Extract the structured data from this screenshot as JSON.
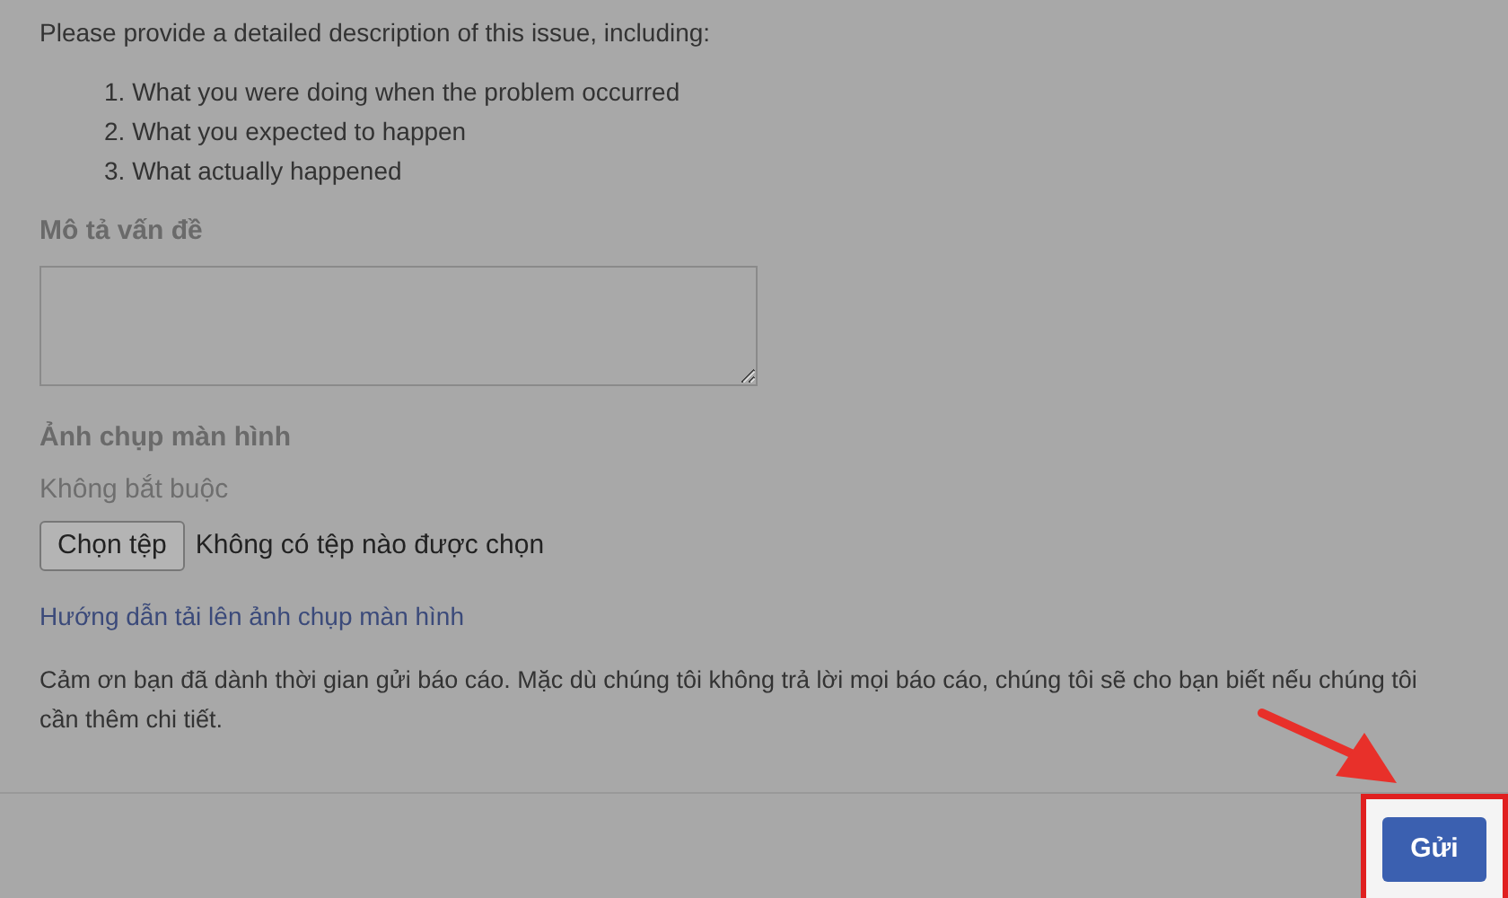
{
  "intro": "Please provide a detailed description of this issue, including:",
  "steps": [
    "1. What you were doing when the problem occurred",
    "2. What you expected to happen",
    "3. What actually happened"
  ],
  "description": {
    "label": "Mô tả vấn đề"
  },
  "screenshot": {
    "label": "Ảnh chụp màn hình",
    "hint": "Không bắt buộc",
    "button": "Chọn tệp",
    "status": "Không có tệp nào được chọn"
  },
  "help_link": "Hướng dẫn tải lên ảnh chụp màn hình",
  "thanks": "Cảm ơn bạn đã dành thời gian gửi báo cáo. Mặc dù chúng tôi không trả lời mọi báo cáo, chúng tôi sẽ cho bạn biết nếu chúng tôi cần thêm chi tiết.",
  "submit": {
    "label": "Gửi",
    "highlighted": true
  }
}
